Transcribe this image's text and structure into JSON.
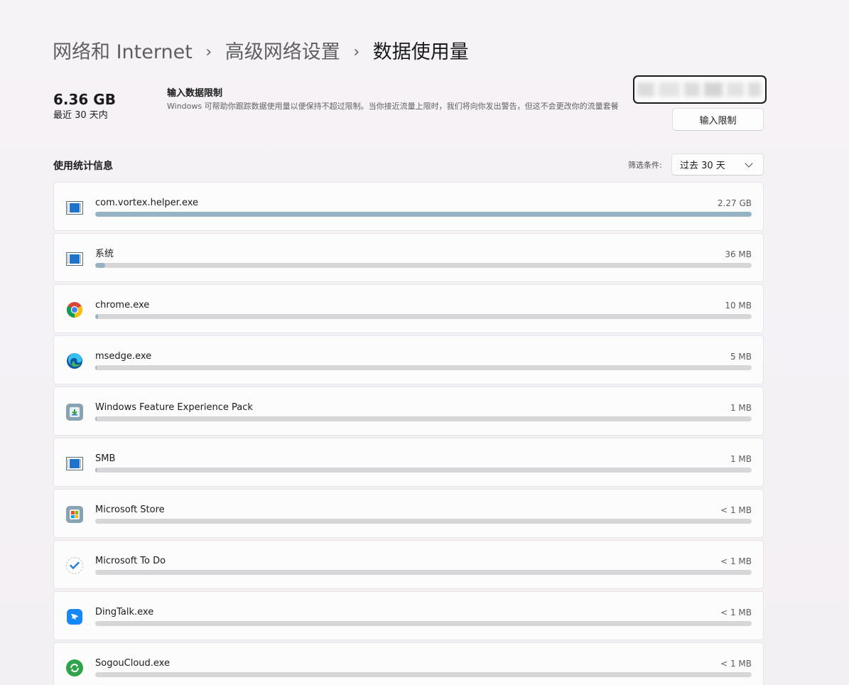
{
  "breadcrumb": {
    "items": [
      "网络和 Internet",
      "高级网络设置",
      "数据使用量"
    ],
    "separator": "›"
  },
  "summary": {
    "amount": "6.36 GB",
    "period": "最近 30 天内"
  },
  "limit": {
    "title": "输入数据限制",
    "description": "Windows 可帮助你跟踪数据使用量以便保持不超过限制。当你接近流量上限时，我们将向你发出警告，但这不会更改你的流量套餐",
    "button_label": "输入限制"
  },
  "stats": {
    "title": "使用统计信息",
    "filter_label": "筛选条件:",
    "filter_value": "过去 30 天"
  },
  "colors": {
    "bar_fill": "#95b3c2",
    "bar_track": "#d6d6d8"
  },
  "apps": [
    {
      "name": "com.vortex.helper.exe",
      "size": "2.27 GB",
      "usage_fraction": 1.0,
      "icon": "app-window-icon"
    },
    {
      "name": "系统",
      "size": "36 MB",
      "usage_fraction": 0.0155,
      "icon": "app-window-icon"
    },
    {
      "name": "chrome.exe",
      "size": "10 MB",
      "usage_fraction": 0.0043,
      "icon": "chrome-icon"
    },
    {
      "name": "msedge.exe",
      "size": "5 MB",
      "usage_fraction": 0.0022,
      "icon": "edge-icon"
    },
    {
      "name": "Windows Feature Experience Pack",
      "size": "1 MB",
      "usage_fraction": 0.0004,
      "icon": "feature-pack-icon"
    },
    {
      "name": "SMB",
      "size": "1 MB",
      "usage_fraction": 0.0004,
      "icon": "app-window-icon"
    },
    {
      "name": "Microsoft Store",
      "size": "< 1 MB",
      "usage_fraction": 0.0,
      "icon": "microsoft-store-icon"
    },
    {
      "name": "Microsoft To Do",
      "size": "< 1 MB",
      "usage_fraction": 0.0,
      "icon": "todo-icon"
    },
    {
      "name": "DingTalk.exe",
      "size": "< 1 MB",
      "usage_fraction": 0.0,
      "icon": "dingtalk-icon"
    },
    {
      "name": "SogouCloud.exe",
      "size": "< 1 MB",
      "usage_fraction": 0.0,
      "icon": "sogou-icon"
    }
  ]
}
